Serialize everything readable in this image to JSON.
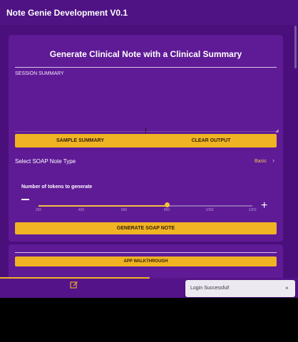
{
  "app": {
    "title": "Note Genie Development V0.1"
  },
  "card": {
    "title": "Generate Clinical Note with a Clinical Summary",
    "session_label": "SESSION SUMMARY",
    "session_value": "",
    "buttons": {
      "sample": "SAMPLE SUMMARY",
      "clear": "CLEAR OUTPUT"
    },
    "soap": {
      "label": "Select SOAP Note Type",
      "value": "Basic"
    },
    "tokens": {
      "label": "Number of tokens to generate",
      "ticks": [
        "250",
        "450",
        "650",
        "850",
        "1050",
        "1250"
      ],
      "min": 250,
      "max": 1250,
      "value": 850
    },
    "generate_label": "GENERATE SOAP NOTE"
  },
  "card2": {
    "walkthrough_label": "APP WALKTHROUGH"
  },
  "toast": {
    "message": "Login Successful!",
    "close": "×"
  },
  "icons": {
    "minus": "minus-icon",
    "plus": "plus-icon",
    "chevron": "chevron-right-icon",
    "edit": "edit-icon",
    "close": "close-icon"
  },
  "colors": {
    "background": "#4a0f7a",
    "card": "#5f1a96",
    "accent": "#f0b323",
    "slider": "#f3c23f"
  }
}
